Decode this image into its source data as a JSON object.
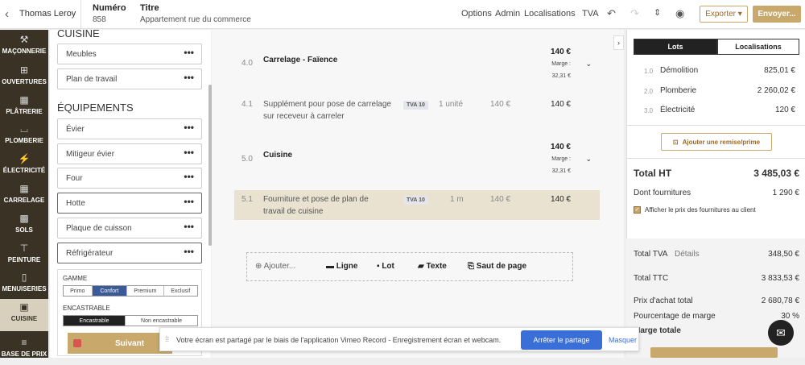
{
  "header": {
    "client": "Thomas Leroy",
    "numero_label": "Numéro",
    "numero_value": "858",
    "titre_label": "Titre",
    "titre_value": "Appartement rue du commerce",
    "links": [
      "Options",
      "Admin",
      "Localisations",
      "TVA"
    ],
    "export_label": "Exporter ▾",
    "send_label": "Envoyer..."
  },
  "sidebar": {
    "items": [
      {
        "label": "MAÇONNERIE",
        "icon": "brick-icon"
      },
      {
        "label": "OUVERTURES",
        "icon": "window-icon"
      },
      {
        "label": "PLÂTRERIE",
        "icon": "wall-icon"
      },
      {
        "label": "PLOMBERIE",
        "icon": "bathtub-icon"
      },
      {
        "label": "ÉLECTRICITÉ",
        "icon": "plug-icon"
      },
      {
        "label": "CARRELAGE",
        "icon": "tiles-icon"
      },
      {
        "label": "SOLS",
        "icon": "floor-icon"
      },
      {
        "label": "PEINTURE",
        "icon": "paint-roller-icon"
      },
      {
        "label": "MENUISERIES",
        "icon": "door-icon"
      },
      {
        "label": "CUISINE",
        "icon": "kitchen-icon"
      },
      {
        "label": "BASE DE PRIX",
        "icon": "database-icon"
      }
    ]
  },
  "elements": {
    "section_top": "CUISINE",
    "top_items": [
      "Meubles",
      "Plan de travail"
    ],
    "section_equip": "ÉQUIPEMENTS",
    "equip_items": [
      "Évier",
      "Mitigeur évier",
      "Four",
      "Hotte",
      "Plaque de cuisson",
      "Réfrigérateur"
    ],
    "dots": "•••"
  },
  "options": {
    "gamme_label": "GAMME",
    "gamme": [
      "Primo",
      "Confort",
      "Premium",
      "Exclusif"
    ],
    "gamme_selected": "Confort",
    "encastrable_label": "ENCASTRABLE",
    "encastrable": [
      "Encastrable",
      "Non encastrable"
    ],
    "encastrable_selected": "Encastrable"
  },
  "lines": [
    {
      "num": "4.0",
      "title": "Carrelage - Faïence",
      "total": "140 €",
      "marge_label": "Marge :",
      "marge": "32,31 €"
    },
    {
      "num": "4.1",
      "desc": "Supplément pour pose de carrelage sur receveur à carreler",
      "tva": "TVA 10",
      "qty": "1 unité",
      "price": "140 €",
      "total": "140 €"
    },
    {
      "num": "5.0",
      "title": "Cuisine",
      "total": "140 €",
      "marge_label": "Marge :",
      "marge": "32,31 €"
    },
    {
      "num": "5.1",
      "desc": "Fourniture et pose de plan de travail de cuisine",
      "tva": "TVA 10",
      "qty": "1 m",
      "price": "140 €",
      "total": "140 €"
    }
  ],
  "addbar": {
    "add": "Ajouter...",
    "ligne": "Ligne",
    "lot": "Lot",
    "texte": "Texte",
    "saut": "Saut de page"
  },
  "right": {
    "tabs": [
      "Lots",
      "Localisations"
    ],
    "lots": [
      {
        "n": "1.0",
        "label": "Démolition",
        "value": "825,01 €"
      },
      {
        "n": "2.0",
        "label": "Plomberie",
        "value": "2 260,02 €"
      },
      {
        "n": "3.0",
        "label": "Électricité",
        "value": "120 €"
      }
    ],
    "remise": "Ajouter une remise/prime",
    "total_ht_label": "Total HT",
    "total_ht": "3 485,03 €",
    "fournitures_label": "Dont fournitures",
    "fournitures": "1 290 €",
    "afficher": "Afficher le prix des fournitures au client",
    "tva_label": "Total TVA",
    "details": "Détails",
    "tva": "348,50 €",
    "ttc_label": "Total TTC",
    "ttc": "3 833,53 €",
    "achat_label": "Prix d'achat total",
    "achat": "2 680,78 €",
    "pct_label": "Pourcentage de marge",
    "pct": "30 %",
    "marge_totale": "Marge totale"
  },
  "banner": {
    "msg": "Votre écran est partagé par le biais de l'application Vimeo Record - Enregistrement écran et webcam.",
    "stop": "Arrêter le partage",
    "hide": "Masquer"
  },
  "footer": {
    "suivant": "Suivant"
  },
  "colors": {
    "accent": "#c8a96b",
    "sidebar": "#3a3325",
    "blue": "#3b6fd8"
  }
}
